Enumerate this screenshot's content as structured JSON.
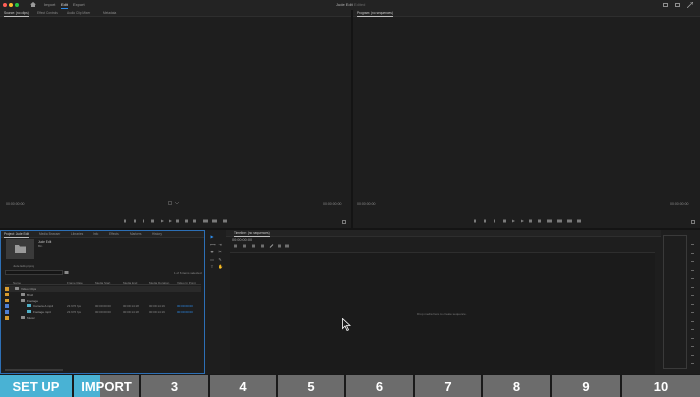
{
  "topbar": {
    "tabs": [
      {
        "label": "Import",
        "active": false
      },
      {
        "label": "Edit",
        "active": true
      },
      {
        "label": "Export",
        "active": false
      }
    ],
    "title": "Jude Edit",
    "title_suffix": "Edited"
  },
  "source_monitor": {
    "tabs": [
      "Source: (no clips)",
      "Effect Controls",
      "Audio Clip Mixer",
      "Metadata"
    ],
    "timecode_left": "00:00:00:00",
    "timecode_right": "00:00:00:00"
  },
  "program_monitor": {
    "tab": "Program: (no sequences)",
    "timecode_left": "00:00:00:00",
    "timecode_right": "00:00:00:00"
  },
  "project_panel": {
    "tabs": [
      "Project: Jude Edit",
      "Media Browser",
      "Libraries",
      "Info",
      "Effects",
      "Markers",
      "History"
    ],
    "bin_name": "Jude Edit",
    "bin_sub": "Bin",
    "path": "Jude Edit.prproj",
    "item_count": "1 of 6 items selected",
    "columns": [
      "Name",
      "Frame Rate",
      "Media Start",
      "Media End",
      "Media Duration",
      "Video In Point"
    ],
    "rows": [
      {
        "name": "Video Clips",
        "kind": "folder",
        "swatch": "#d79b2e",
        "indent": 0,
        "frame_rate": "",
        "start": "",
        "end": "",
        "duration": "",
        "in": ""
      },
      {
        "name": "Broll",
        "kind": "folder",
        "swatch": "#d79b2e",
        "indent": 1,
        "frame_rate": "",
        "start": "",
        "end": "",
        "duration": "",
        "in": ""
      },
      {
        "name": "Footage",
        "kind": "folder",
        "swatch": "#d79b2e",
        "indent": 1,
        "frame_rate": "",
        "start": "",
        "end": "",
        "duration": "",
        "in": ""
      },
      {
        "name": "Camera A.mp4",
        "kind": "clip",
        "swatch": "#4f7fd3",
        "indent": 2,
        "frame_rate": "23.976 fps",
        "start": "00:00:00:00",
        "end": "00:09:14:18",
        "duration": "00:09:14:19",
        "in": "00:00:00:00"
      },
      {
        "name": "Footage.mp4",
        "kind": "clip",
        "swatch": "#4f7fd3",
        "indent": 2,
        "frame_rate": "23.976 fps",
        "start": "00:00:00:00",
        "end": "00:09:14:18",
        "duration": "00:09:14:19",
        "in": "00:00:00:00"
      },
      {
        "name": "Music",
        "kind": "folder",
        "swatch": "#d79b2e",
        "indent": 1,
        "frame_rate": "",
        "start": "",
        "end": "",
        "duration": "",
        "in": ""
      }
    ]
  },
  "tools": [
    "▶",
    "⇥",
    "⟷",
    "✂",
    "⬌",
    "✎",
    "▭",
    "✋",
    "T"
  ],
  "timeline": {
    "tab": "Timeline: (no sequences)",
    "timecode": "00:00:00:00",
    "drop_hint": "Drop media here to create sequence."
  },
  "stepbar": {
    "steps": [
      "SET UP",
      "IMPORT",
      "3",
      "4",
      "5",
      "6",
      "7",
      "8",
      "9",
      "10"
    ]
  },
  "colors": {
    "accent": "#2d8ceb",
    "step_active": "#49b2d4",
    "step_inactive": "#6c6c6c"
  }
}
